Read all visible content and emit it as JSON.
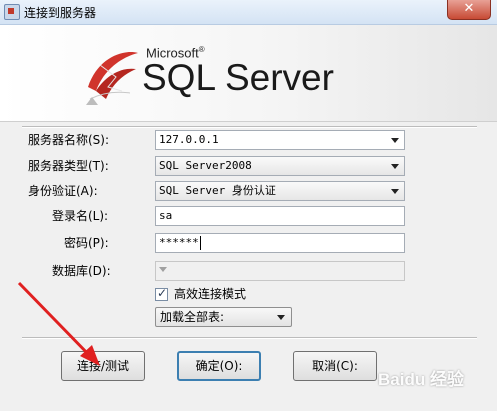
{
  "window": {
    "title": "连接到服务器",
    "close_symbol": "✕"
  },
  "banner": {
    "company": "Microsoft",
    "registered_mark": "®",
    "product": "SQL Server"
  },
  "form": {
    "server_name": {
      "label": "服务器名称(S):",
      "value": "127.0.0.1"
    },
    "server_type": {
      "label": "服务器类型(T):",
      "value": "SQL Server2008"
    },
    "authentication": {
      "label": "身份验证(A):",
      "value": "SQL Server 身份认证"
    },
    "login": {
      "label": "登录名(L):",
      "value": "sa"
    },
    "password": {
      "label": "密码(P):",
      "value": "******"
    },
    "database": {
      "label": "数据库(D):",
      "value": ""
    },
    "efficient_mode": {
      "label": "高效连接模式",
      "checked": true
    },
    "load_option": {
      "value": "加载全部表:"
    }
  },
  "buttons": {
    "connect_test": "连接/测试",
    "ok": "确定(O):",
    "cancel": "取消(C):"
  },
  "watermark": "Baidu 经验",
  "colors": {
    "annotation_arrow": "#e02020",
    "logo_red": "#d0342c",
    "default_button_border": "#3c7fb1"
  }
}
